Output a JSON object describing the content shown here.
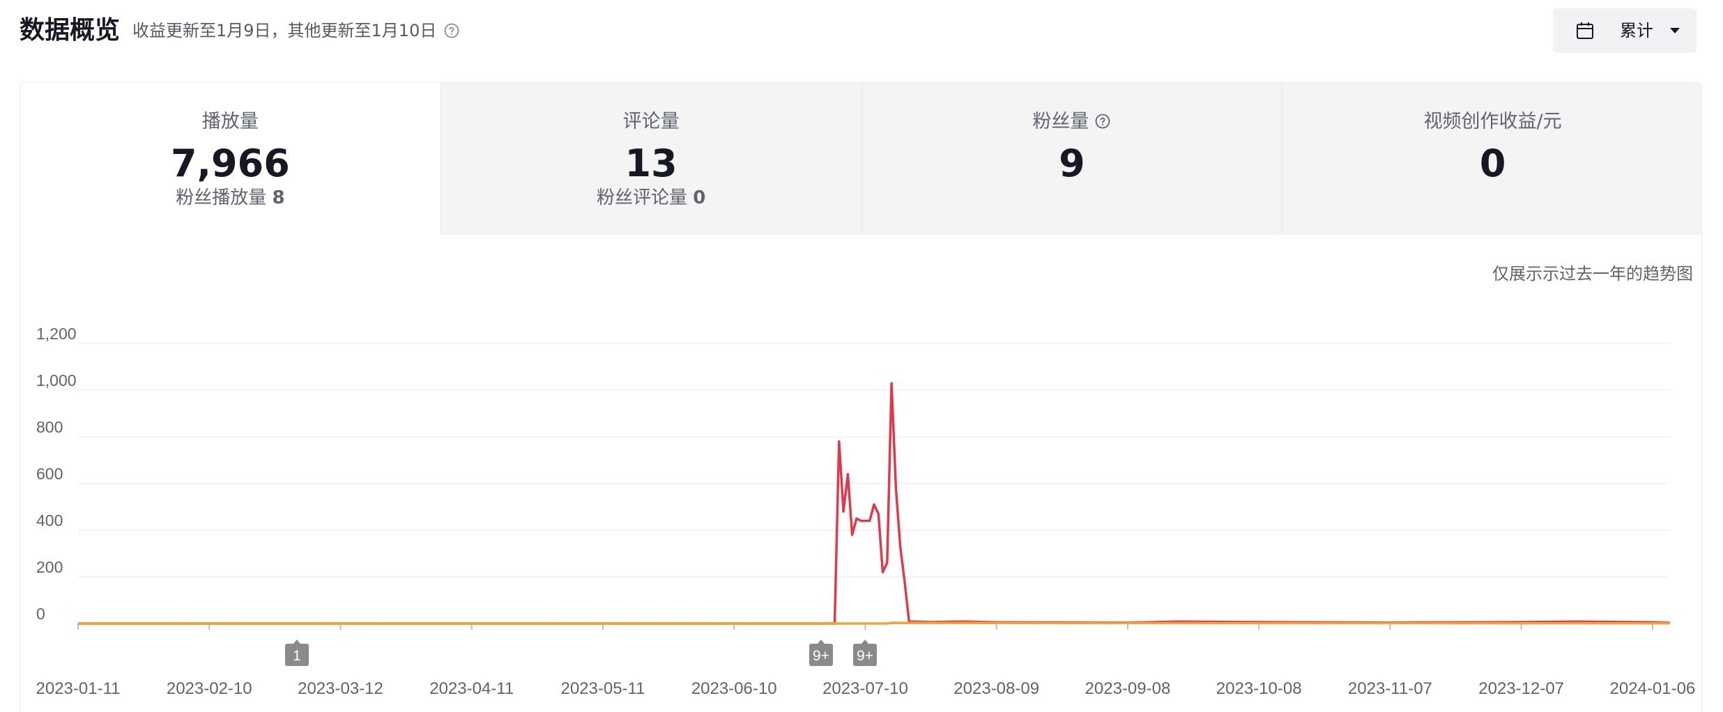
{
  "header": {
    "title": "数据概览",
    "subtitle": "收益更新至1月9日，其他更新至1月10日",
    "period_label": "累计",
    "help_icon": "question-circle-icon",
    "calendar_icon": "calendar-icon"
  },
  "tabs": [
    {
      "label": "播放量",
      "value": "7,966",
      "sub_label": "粉丝播放量",
      "sub_value": "8",
      "active": true
    },
    {
      "label": "评论量",
      "value": "13",
      "sub_label": "粉丝评论量",
      "sub_value": "0",
      "active": false
    },
    {
      "label": "粉丝量",
      "value": "9",
      "sub_label": "",
      "sub_value": "",
      "active": false,
      "help": true
    },
    {
      "label": "视频创作收益/元",
      "value": "0",
      "sub_label": "",
      "sub_value": "",
      "active": false
    }
  ],
  "chart_note": "仅展示示过去一年的趋势图",
  "colors": {
    "series_red": "#e0394b",
    "series_orange": "#f2a33a",
    "grid": "#f0f0f0",
    "marker": "#8a8a8a"
  },
  "chart_data": {
    "type": "line",
    "xlabel": "",
    "ylabel": "",
    "ylim": [
      0,
      1200
    ],
    "yticks": [
      0,
      200,
      400,
      600,
      800,
      1000,
      1200
    ],
    "ytick_labels": [
      "0",
      "200",
      "400",
      "600",
      "800",
      "1,000",
      "1,200"
    ],
    "xtick_labels": [
      "2023-01-11",
      "2023-02-10",
      "2023-03-12",
      "2023-04-11",
      "2023-05-11",
      "2023-06-10",
      "2023-07-10",
      "2023-08-09",
      "2023-09-08",
      "2023-10-08",
      "2023-11-07",
      "2023-12-07",
      "2024-01-06"
    ],
    "x_start": "2023-01-11",
    "x_end": "2024-01-10",
    "grid": true,
    "markers": [
      {
        "date": "2023-03-12",
        "label": "1"
      },
      {
        "date": "2023-07-00",
        "label": "9+"
      },
      {
        "date": "2023-07-10",
        "label": "9+"
      }
    ],
    "series": [
      {
        "values": [
          [
            "2023-01-11",
            0
          ],
          [
            "2023-07-03",
            0
          ],
          [
            "2023-07-04",
            780
          ],
          [
            "2023-07-05",
            480
          ],
          [
            "2023-07-06",
            640
          ],
          [
            "2023-07-07",
            380
          ],
          [
            "2023-07-08",
            450
          ],
          [
            "2023-07-09",
            440
          ],
          [
            "2023-07-10",
            440
          ],
          [
            "2023-07-11",
            440
          ],
          [
            "2023-07-12",
            510
          ],
          [
            "2023-07-13",
            470
          ],
          [
            "2023-07-14",
            220
          ],
          [
            "2023-07-15",
            260
          ],
          [
            "2023-07-16",
            1030
          ],
          [
            "2023-07-17",
            580
          ],
          [
            "2023-07-18",
            330
          ],
          [
            "2023-07-19",
            180
          ],
          [
            "2023-07-20",
            10
          ],
          [
            "2023-07-21",
            8
          ],
          [
            "2023-07-25",
            6
          ],
          [
            "2023-08-01",
            8
          ],
          [
            "2023-08-09",
            5
          ],
          [
            "2023-09-08",
            4
          ],
          [
            "2023-09-20",
            8
          ],
          [
            "2023-10-08",
            6
          ],
          [
            "2023-11-07",
            4
          ],
          [
            "2023-12-07",
            6
          ],
          [
            "2023-12-20",
            8
          ],
          [
            "2024-01-06",
            5
          ],
          [
            "2024-01-10",
            3
          ]
        ]
      },
      {
        "values": [
          [
            "2023-01-11",
            0
          ],
          [
            "2023-07-15",
            0
          ],
          [
            "2023-07-16",
            3
          ],
          [
            "2023-08-09",
            2
          ],
          [
            "2024-01-10",
            1
          ]
        ]
      }
    ]
  }
}
